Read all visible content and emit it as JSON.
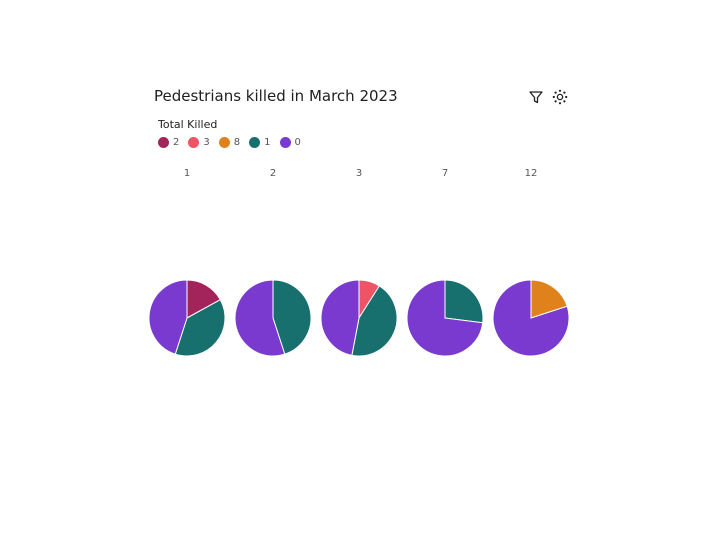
{
  "title": "Pedestrians killed in March 2023",
  "toolbar": {
    "filter_icon": "filter-icon",
    "settings_icon": "settings-icon"
  },
  "legend": {
    "title": "Total Killed",
    "items": [
      {
        "label": "2",
        "color": "#a3245b"
      },
      {
        "label": "3",
        "color": "#ee5465"
      },
      {
        "label": "8",
        "color": "#e0821c"
      },
      {
        "label": "1",
        "color": "#17706e"
      },
      {
        "label": "0",
        "color": "#7a3ad0"
      }
    ]
  },
  "chart_data": {
    "type": "pie",
    "categories": [
      "1",
      "2",
      "3",
      "7",
      "12"
    ],
    "legend_title": "Total Killed",
    "slice_order": [
      "2",
      "3",
      "8",
      "1",
      "0"
    ],
    "colors": {
      "2": "#a3245b",
      "3": "#ee5465",
      "8": "#e0821c",
      "1": "#17706e",
      "0": "#7a3ad0"
    },
    "pies": [
      {
        "category": "1",
        "slices": [
          {
            "key": "2",
            "value": 0.17
          },
          {
            "key": "1",
            "value": 0.38
          },
          {
            "key": "0",
            "value": 0.45
          }
        ]
      },
      {
        "category": "2",
        "slices": [
          {
            "key": "1",
            "value": 0.45
          },
          {
            "key": "0",
            "value": 0.55
          }
        ]
      },
      {
        "category": "3",
        "slices": [
          {
            "key": "3",
            "value": 0.09
          },
          {
            "key": "1",
            "value": 0.44
          },
          {
            "key": "0",
            "value": 0.47
          }
        ]
      },
      {
        "category": "7",
        "slices": [
          {
            "key": "1",
            "value": 0.27
          },
          {
            "key": "0",
            "value": 0.73
          }
        ]
      },
      {
        "category": "12",
        "slices": [
          {
            "key": "8",
            "value": 0.2
          },
          {
            "key": "0",
            "value": 0.8
          }
        ]
      }
    ]
  }
}
